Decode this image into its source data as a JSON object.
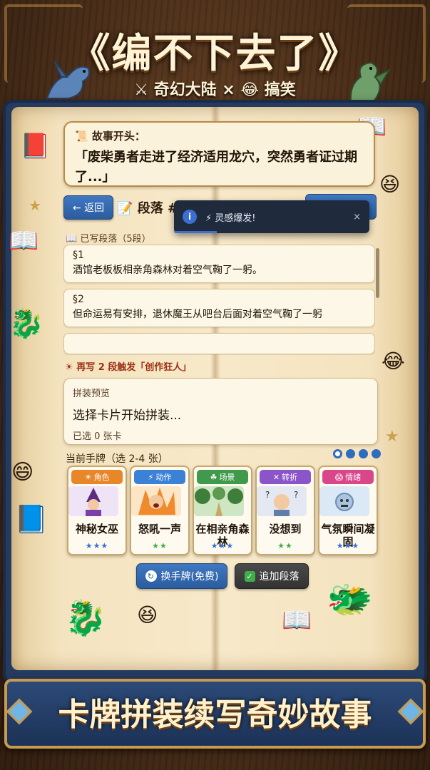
{
  "header": {
    "title": "《编不下去了》",
    "genre_1": "奇幻大陆",
    "separator": "×",
    "genre_2": "搞笑"
  },
  "opening": {
    "label": "故事开头：",
    "text": "「废柴勇者走进了经济适用龙穴，突然勇者证过期了...」"
  },
  "toolbar": {
    "back_label": "← 返回",
    "paragraph_label": "段落 #"
  },
  "toast": {
    "info_symbol": "i",
    "message": "⚡ 灵感爆发!",
    "close": "×",
    "progress_fraction": 0.22
  },
  "written": {
    "heading": "已写段落（5段）",
    "paragraphs": [
      {
        "num": "§1",
        "text": "酒馆老板板相亲角森林对着空气鞠了一躬。"
      },
      {
        "num": "§2",
        "text": "但命运易有安排，退休魔王从吧台后面对着空气鞠了一躬"
      }
    ]
  },
  "trigger": "再写 2 段触发「创作狂人」",
  "preview": {
    "title": "拼装预览",
    "text": "选择卡片开始拼装...",
    "count": "已选 0 张卡"
  },
  "hand": {
    "heading": "当前手牌（选 2-4 张）",
    "cards": [
      {
        "tag": "角色",
        "name": "神秘女巫",
        "stars": "★★★",
        "color": "#e8862a"
      },
      {
        "tag": "动作",
        "name": "怒吼一声",
        "stars": "★★",
        "color": "#3b82d6"
      },
      {
        "tag": "场景",
        "name": "在相亲角森林",
        "stars": "★★★",
        "color": "#3f9a4b"
      },
      {
        "tag": "转折",
        "name": "没想到",
        "stars": "★★",
        "color": "#8a55c9"
      },
      {
        "tag": "情绪",
        "name": "气氛瞬间凝固",
        "stars": "★★★",
        "color": "#d9468a"
      }
    ]
  },
  "actions": {
    "swap": "换手牌(免费)",
    "add": "追加段落"
  },
  "banner": "卡牌拼装续写奇妙故事"
}
